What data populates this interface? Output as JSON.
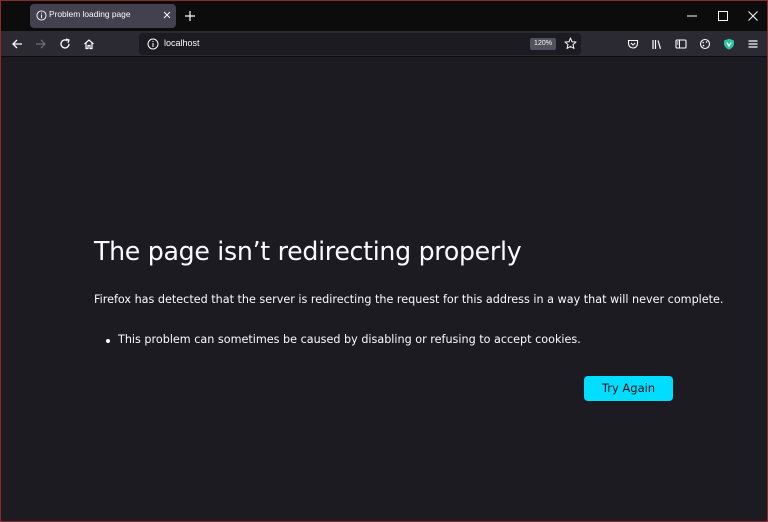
{
  "colors": {
    "background": "#1c1b22",
    "titlebar": "#0c0c0d",
    "toolbar": "#2b2a33",
    "active_tab": "#42414d",
    "accent_button": "#00ddff",
    "window_border": "#8c2a30",
    "shield_green": "#2ac3a2"
  },
  "tab": {
    "title": "Problem loading page",
    "icon": "info-icon"
  },
  "urlbar": {
    "url": "localhost",
    "zoom": "120%"
  },
  "toolbar_icons": [
    "back-icon",
    "forward-icon",
    "reload-icon",
    "home-icon",
    "pocket-icon",
    "library-icon",
    "sidebar-icon",
    "extensions-icon",
    "shield-icon",
    "menu-icon"
  ],
  "error": {
    "title": "The page isn’t redirecting properly",
    "description": "Firefox has detected that the server is redirecting the request for this address in a way that will never complete.",
    "bullets": [
      "This problem can sometimes be caused by disabling or refusing to accept cookies."
    ],
    "button_label": "Try Again"
  }
}
